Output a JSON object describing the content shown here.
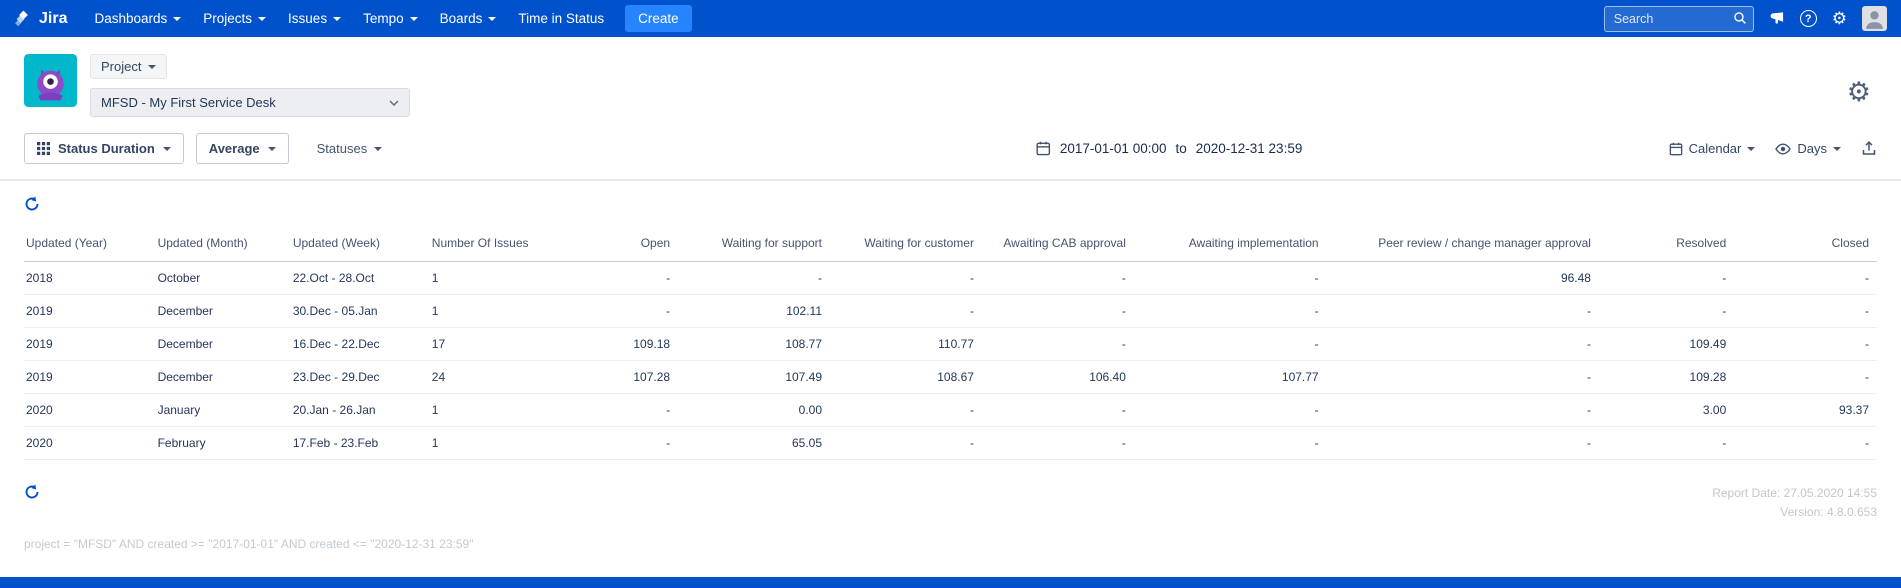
{
  "navbar": {
    "brand": "Jira",
    "items": [
      {
        "label": "Dashboards",
        "caret": true
      },
      {
        "label": "Projects",
        "caret": true
      },
      {
        "label": "Issues",
        "caret": true
      },
      {
        "label": "Tempo",
        "caret": true
      },
      {
        "label": "Boards",
        "caret": true
      },
      {
        "label": "Time in Status",
        "caret": false
      }
    ],
    "create_label": "Create",
    "search_placeholder": "Search"
  },
  "project_header": {
    "scope_label": "Project",
    "project_name": "MFSD - My First Service Desk"
  },
  "toolbar": {
    "report_type": "Status Duration",
    "metric": "Average",
    "statuses": "Statuses",
    "date_from": "2017-01-01 00:00",
    "date_separator": "to",
    "date_to": "2020-12-31 23:59",
    "calendar_label": "Calendar",
    "unit_label": "Days"
  },
  "table": {
    "columns": [
      {
        "label": "Updated (Year)",
        "align": "left"
      },
      {
        "label": "Updated (Month)",
        "align": "left"
      },
      {
        "label": "Updated (Week)",
        "align": "left"
      },
      {
        "label": "Number Of Issues",
        "align": "left"
      },
      {
        "label": "Open",
        "align": "right"
      },
      {
        "label": "Waiting for support",
        "align": "right"
      },
      {
        "label": "Waiting for customer",
        "align": "right"
      },
      {
        "label": "Awaiting CAB approval",
        "align": "right"
      },
      {
        "label": "Awaiting implementation",
        "align": "right"
      },
      {
        "label": "Peer review / change manager approval",
        "align": "right"
      },
      {
        "label": "Resolved",
        "align": "right"
      },
      {
        "label": "Closed",
        "align": "right"
      }
    ],
    "rows": [
      [
        "2018",
        "October",
        "22.Oct - 28.Oct",
        "1",
        "-",
        "-",
        "-",
        "-",
        "-",
        "96.48",
        "-",
        "-"
      ],
      [
        "2019",
        "December",
        "30.Dec - 05.Jan",
        "1",
        "-",
        "102.11",
        "-",
        "-",
        "-",
        "-",
        "-",
        "-"
      ],
      [
        "2019",
        "December",
        "16.Dec - 22.Dec",
        "17",
        "109.18",
        "108.77",
        "110.77",
        "-",
        "-",
        "-",
        "109.49",
        "-"
      ],
      [
        "2019",
        "December",
        "23.Dec - 29.Dec",
        "24",
        "107.28",
        "107.49",
        "108.67",
        "106.40",
        "107.77",
        "-",
        "109.28",
        "-"
      ],
      [
        "2020",
        "January",
        "20.Jan - 26.Jan",
        "1",
        "-",
        "0.00",
        "-",
        "-",
        "-",
        "-",
        "3.00",
        "93.37"
      ],
      [
        "2020",
        "February",
        "17.Feb - 23.Feb",
        "1",
        "-",
        "65.05",
        "-",
        "-",
        "-",
        "-",
        "-",
        "-"
      ]
    ]
  },
  "footer": {
    "report_date": "Report Date: 27.05.2020 14:55",
    "version": "Version: 4.8.0.653",
    "jql": "project = \"MFSD\" AND created >= \"2017-01-01\" AND created <= \"2020-12-31 23:59\""
  },
  "colors": {
    "navbar_blue": "#0052CC",
    "create_button_blue": "#2684FF",
    "refresh_blue": "#0052CC",
    "avatar_teal": "#00B8C9",
    "avatar_monster_purple": "#8D4BC7"
  }
}
